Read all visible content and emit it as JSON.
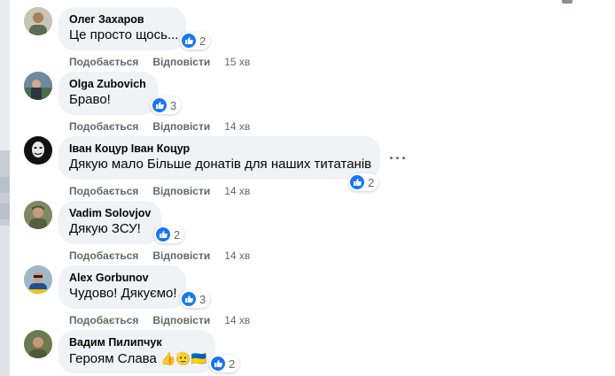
{
  "actions": {
    "like": "Подобається",
    "reply": "Відповісти"
  },
  "comments": [
    {
      "author": "Олег Захаров",
      "text": "Це просто щось...",
      "reactions": "2",
      "time": "15 хв"
    },
    {
      "author": "Olga Zubovich",
      "text": "Браво!",
      "reactions": "3",
      "time": "14 хв"
    },
    {
      "author": "Іван Коцур Іван Коцур",
      "text": "Дякую мало Більше донатів для наших титатанів",
      "reactions": "2",
      "time": "14 хв"
    },
    {
      "author": "Vadim Solovjov",
      "text": "Дякую ЗСУ!",
      "reactions": "2",
      "time": "14 хв"
    },
    {
      "author": "Alex Gorbunov",
      "text": "Чудово! Дякуємо!",
      "reactions": "3",
      "time": "14 хв"
    },
    {
      "author": "Вадим Пилипчук",
      "text": "Героям Слава",
      "emoji": "👍🫡🇺🇦",
      "reactions": "2",
      "time": ""
    }
  ],
  "icons": {
    "reaction": "like-thumbs-up-icon",
    "more": "more-horizontal-icon"
  },
  "colors": {
    "accent": "#1877f2",
    "bubble": "#f0f2f5",
    "muted": "#65676b"
  }
}
